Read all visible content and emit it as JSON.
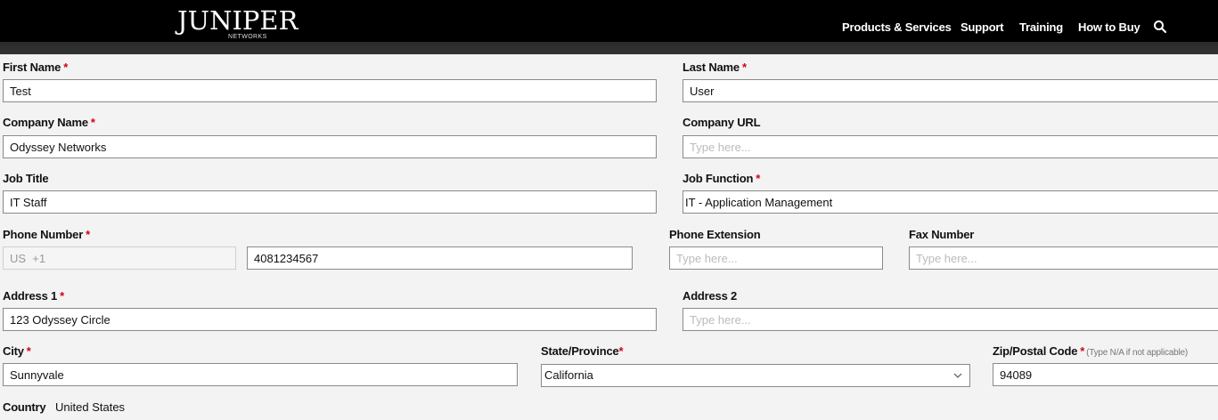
{
  "header": {
    "logo_text": "JUNIPER",
    "logo_sub": "NETWORKS",
    "nav": [
      "Products & Services",
      "Support",
      "Training",
      "How to Buy"
    ],
    "search_icon": "search-icon"
  },
  "form": {
    "first_name": {
      "label": "First Name",
      "required": "*",
      "value": "Test"
    },
    "last_name": {
      "label": "Last Name",
      "required": "*",
      "value": "User"
    },
    "company_name": {
      "label": "Company Name",
      "required": "*",
      "value": "Odyssey Networks"
    },
    "company_url": {
      "label": "Company URL",
      "placeholder": "Type here..."
    },
    "job_title": {
      "label": "Job Title",
      "value": "IT Staff"
    },
    "job_function": {
      "label": "Job Function",
      "required": "*",
      "value": "IT - Application Management"
    },
    "phone_number": {
      "label": "Phone Number",
      "required": "*",
      "country_code": "US  +1",
      "value": "4081234567"
    },
    "phone_extension": {
      "label": "Phone Extension",
      "placeholder": "Type here..."
    },
    "fax_number": {
      "label": "Fax Number",
      "placeholder": "Type here..."
    },
    "address1": {
      "label": "Address 1",
      "required": "*",
      "value": "123 Odyssey Circle"
    },
    "address2": {
      "label": "Address 2",
      "placeholder": "Type here..."
    },
    "city": {
      "label": "City",
      "required": "*",
      "value": "Sunnyvale"
    },
    "state": {
      "label": "State/Province",
      "required": "*",
      "value": "California"
    },
    "zip": {
      "label": "Zip/Postal Code",
      "required": "*",
      "note": "(Type N/A if not applicable)",
      "value": "94089"
    },
    "country": {
      "label": "Country",
      "value": "United States"
    }
  },
  "colors": {
    "header_bg": "#000000",
    "required": "#d0021b",
    "page_bg": "#f3f3f3"
  }
}
